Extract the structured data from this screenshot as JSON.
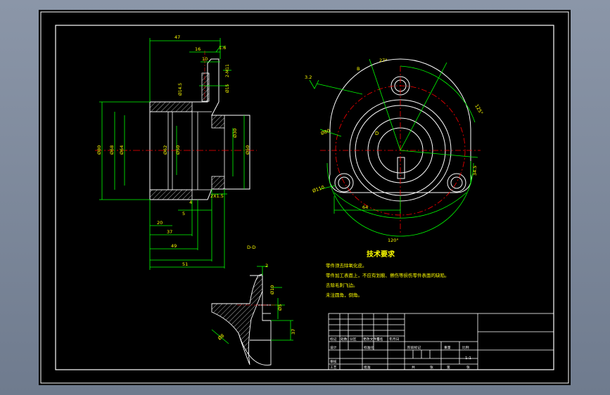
{
  "drawing": {
    "dims_top": [
      "47",
      "16",
      "10",
      "1.6"
    ],
    "dims_small": [
      "2-M11",
      "Ø14.5",
      "Ø15"
    ],
    "dims_left": [
      "Ø80",
      "Ø68",
      "Ø64",
      "Ø62",
      "Ø50"
    ],
    "dims_right": [
      "Ø30",
      "Ø50"
    ],
    "chamfer": "2X1.5",
    "dims_bottom": [
      "4",
      "5",
      "20",
      "37",
      "49",
      "51"
    ],
    "right_view": {
      "angle1": "27°",
      "angle2": "125°",
      "angle3": "120°",
      "label_b": "B",
      "label_d": "D",
      "roughness": "3.2",
      "dia_big": "Ø80",
      "dia_hole": "Ø110",
      "dim_64": "64",
      "dim_side": "34.5"
    },
    "section": {
      "title": "D-D",
      "dims": [
        "2",
        "Ø10",
        "Ø5",
        "37",
        "Ø8"
      ]
    },
    "tech_title": "技术要求",
    "tech_notes": [
      "零件须去除氧化皮。",
      "零件加工表面上，不应有划痕、擦伤等损伤零件表面的缺陷。",
      "去除毛刺飞边。",
      "未注圆角，倒角。"
    ],
    "title_block": {
      "cells": [
        "标记",
        "处数",
        "分区",
        "更改文件号",
        "签名",
        "年月日",
        "设计",
        "标准化",
        "阶段标记",
        "重量",
        "比例",
        "审核",
        "工艺",
        "批准",
        "共",
        "张",
        "第",
        "张"
      ],
      "scale": "1:1"
    }
  }
}
